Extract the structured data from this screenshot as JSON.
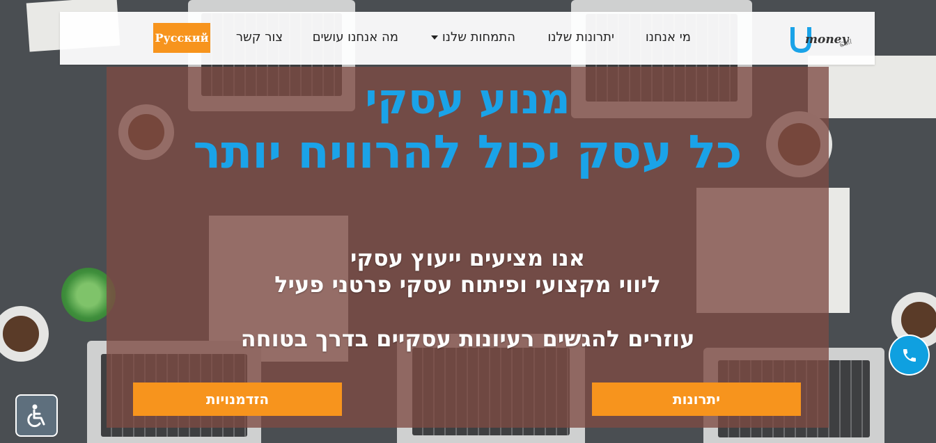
{
  "nav": {
    "items": [
      {
        "key": "about",
        "label": "מי אנחנו"
      },
      {
        "key": "advantages",
        "label": "יתרונות שלנו"
      },
      {
        "key": "specialties",
        "label": "התמחות שלנו",
        "has_dropdown": true
      },
      {
        "key": "services",
        "label": "מה אנחנו עושים"
      },
      {
        "key": "contact",
        "label": "צור קשר"
      }
    ],
    "language_button": "Русский"
  },
  "logo": {
    "letter": "U",
    "word": "money",
    "suffix": "Call"
  },
  "hero": {
    "title_line1": "מנוע עסקי",
    "title_line2": "כל עסק יכול להרוויח יותר",
    "sub_line1": "אנו מציעים ייעוץ עסקי",
    "sub_line2": "ליווי מקצועי ופיתוח עסקי פרטני פעיל",
    "sub_line3": "עוזרים להגשים רעיונות עסקיים בדרך בטוחה"
  },
  "buttons": {
    "opportunities": "הזדמנויות",
    "advantages": "יתרונות"
  },
  "floating": {
    "phone_icon": "phone-icon",
    "accessibility_icon": "wheelchair-icon"
  },
  "colors": {
    "accent_blue": "#1aa3e8",
    "accent_orange": "#f7941d",
    "overlay": "#7e4a42"
  }
}
